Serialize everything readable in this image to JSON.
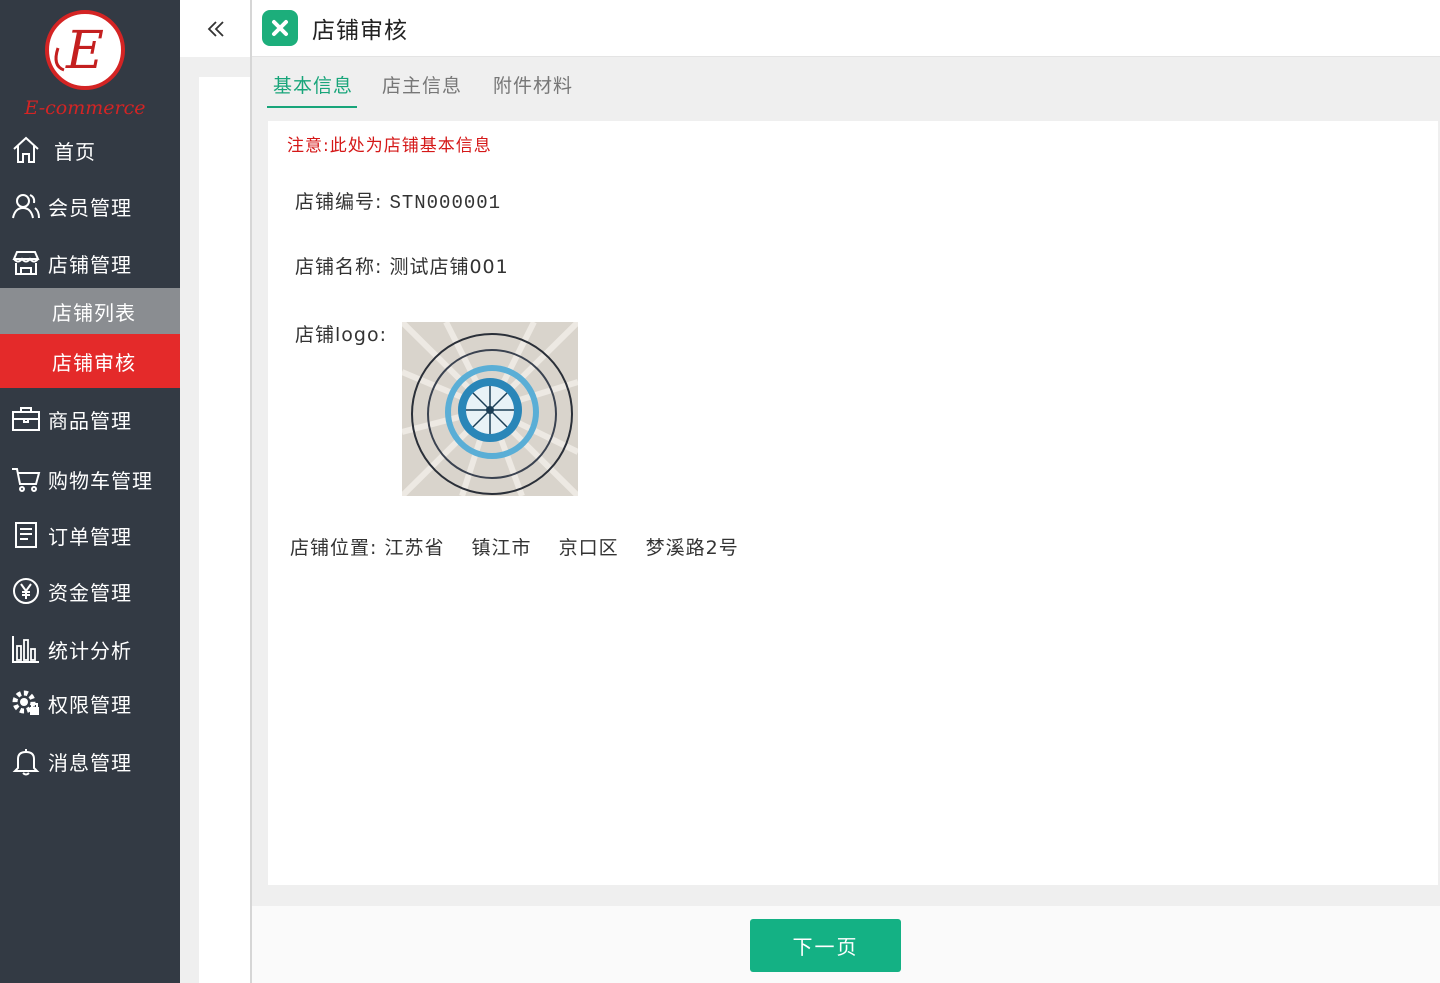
{
  "brand": {
    "logo_text": "E-commerce",
    "logo_letter": "E",
    "accent": "#e42a2a"
  },
  "sidebar": {
    "items": [
      {
        "label": "首页",
        "icon": "home-icon"
      },
      {
        "label": "会员管理",
        "icon": "users-icon"
      },
      {
        "label": "店铺管理",
        "icon": "store-icon"
      },
      {
        "label": "商品管理",
        "icon": "briefcase-icon"
      },
      {
        "label": "购物车管理",
        "icon": "cart-icon"
      },
      {
        "label": "订单管理",
        "icon": "document-icon"
      },
      {
        "label": "资金管理",
        "icon": "yen-icon"
      },
      {
        "label": "统计分析",
        "icon": "bar-chart-icon"
      },
      {
        "label": "权限管理",
        "icon": "gear-lock-icon"
      },
      {
        "label": "消息管理",
        "icon": "bell-icon"
      }
    ],
    "sub_items": [
      {
        "label": "店铺列表"
      },
      {
        "label": "店铺审核",
        "active": true
      }
    ]
  },
  "header": {
    "title": "店铺审核",
    "close_color": "#1cae7b"
  },
  "tabs": [
    {
      "label": "基本信息",
      "active": true
    },
    {
      "label": "店主信息"
    },
    {
      "label": "附件材料"
    }
  ],
  "content": {
    "notice": "注意:此处为店铺基本信息",
    "store_no_label": "店铺编号:",
    "store_no": "STN000001",
    "store_name_label": "店铺名称:",
    "store_name": "测试店铺001",
    "store_logo_label": "店铺logo:",
    "location_label": "店铺位置:",
    "location": {
      "province": "江苏省",
      "city": "镇江市",
      "district": "京口区",
      "street": "梦溪路2号"
    }
  },
  "footer": {
    "next_label": "下一页",
    "button_color": "#14b184"
  }
}
